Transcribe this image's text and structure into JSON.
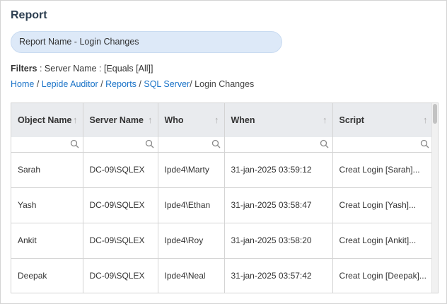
{
  "page": {
    "title": "Report",
    "report_name": "Report Name - Login Changes"
  },
  "filters": {
    "label": "Filters",
    "value": " : Server Name : [Equals [All]]"
  },
  "breadcrumb": {
    "home": "Home",
    "lepide": "Lepide Auditor",
    "reports": "Reports",
    "sql": "SQL Server",
    "current": " Login Changes"
  },
  "table": {
    "columns": [
      "Object Name",
      "Server Name",
      "Who",
      "When",
      "Script"
    ],
    "sort_glyph": "↑",
    "rows": [
      [
        "Sarah",
        "DC-09\\SQLEX",
        "Ipde4\\Marty",
        "31-jan-2025 03:59:12",
        "Creat Login [Sarah]..."
      ],
      [
        "Yash",
        "DC-09\\SQLEX",
        "Ipde4\\Ethan",
        "31-jan-2025 03:58:47",
        "Creat Login [Yash]..."
      ],
      [
        "Ankit",
        "DC-09\\SQLEX",
        "Ipde4\\Roy",
        "31-jan-2025 03:58:20",
        "Creat Login [Ankit]..."
      ],
      [
        "Deepak",
        "DC-09\\SQLEX",
        "Ipde4\\Neal",
        "31-jan-2025 03:57:42",
        "Creat Login [Deepak]..."
      ]
    ]
  }
}
